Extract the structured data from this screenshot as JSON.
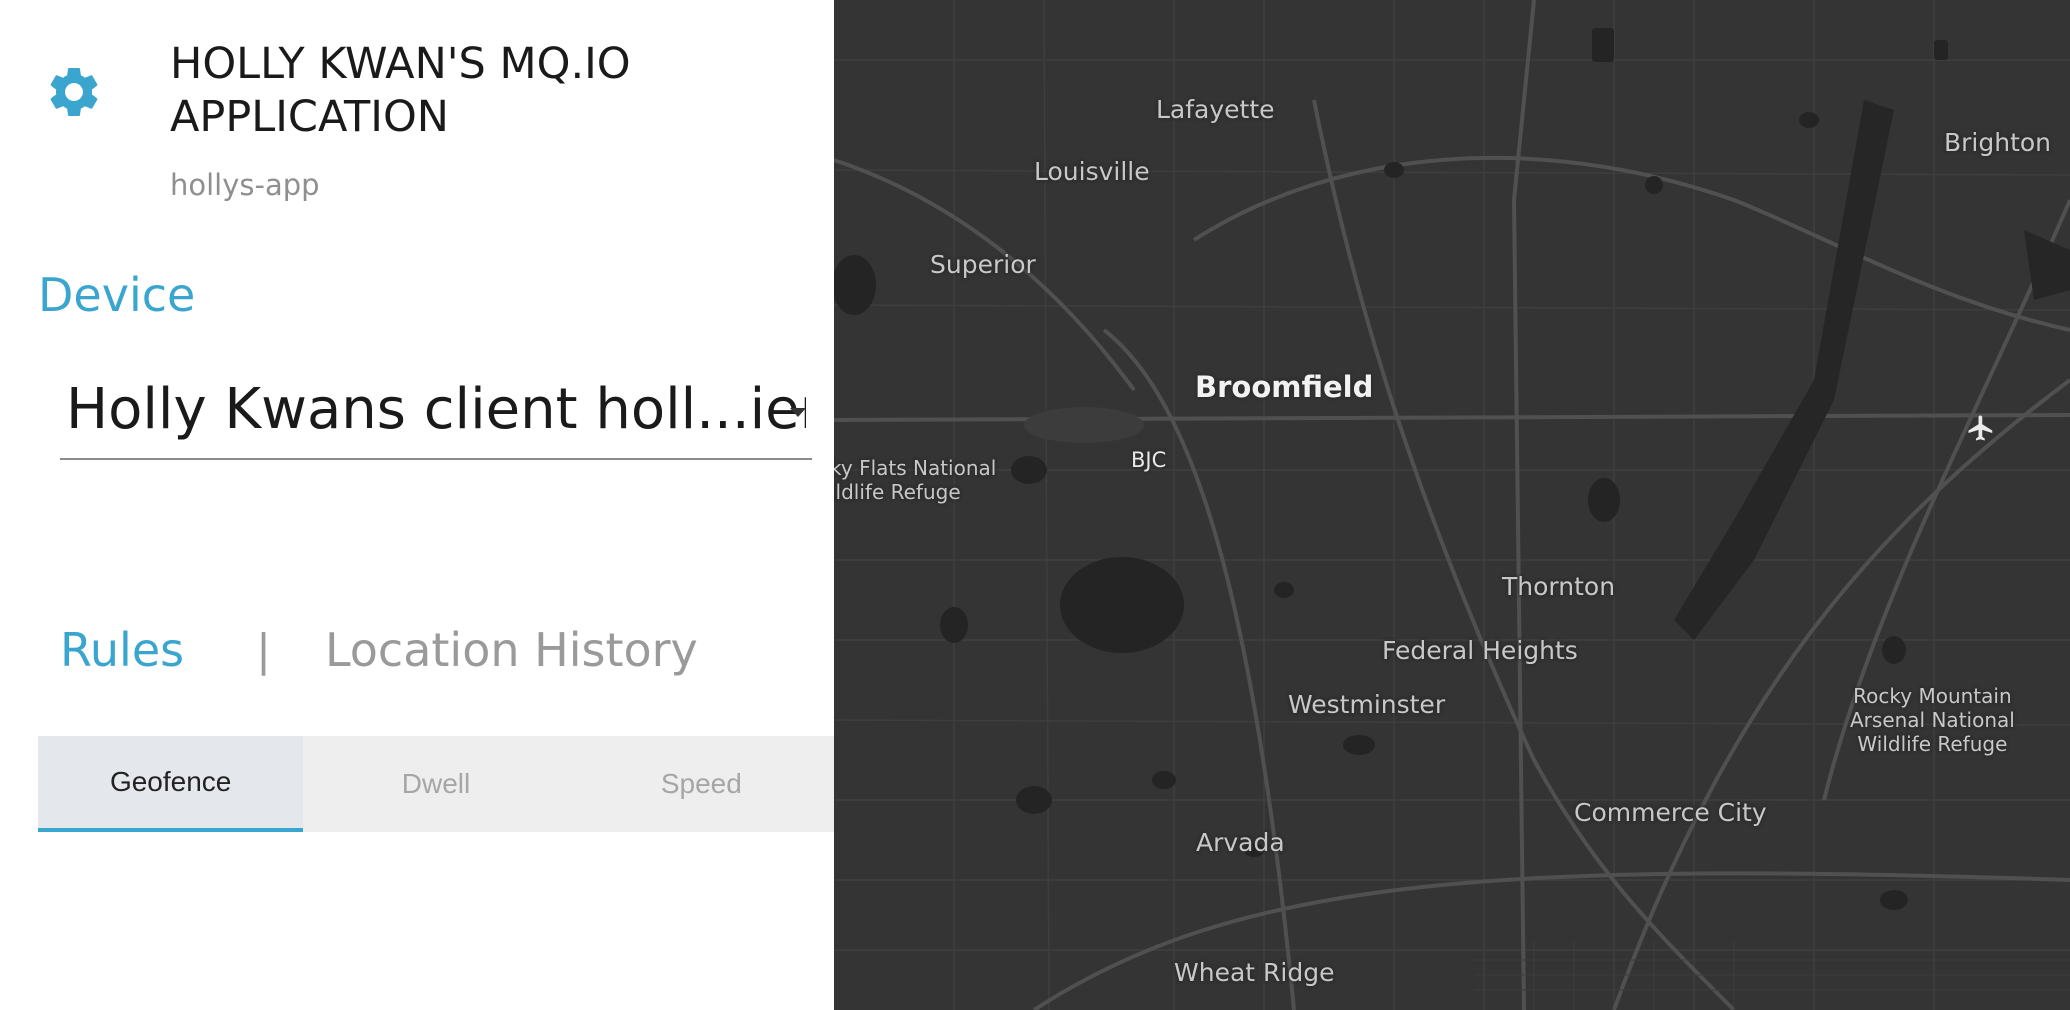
{
  "app": {
    "title": "HOLLY KWAN'S MQ.IO APPLICATION",
    "app_id": "hollys-app",
    "settings_icon": "gear-icon",
    "accent_color": "#3aa5cf"
  },
  "device": {
    "heading": "Device",
    "selected": "Holly Kwans client holl...ient"
  },
  "main_tabs": {
    "rules": "Rules",
    "divider": "|",
    "location_history": "Location History",
    "active": "Rules"
  },
  "rule_tabs": {
    "items": [
      {
        "label": "Geofence",
        "active": true
      },
      {
        "label": "Dwell",
        "active": false
      },
      {
        "label": "Speed",
        "active": false
      }
    ]
  },
  "map": {
    "labels": {
      "lafayette": "Lafayette",
      "louisville": "Louisville",
      "brighton": "Brighton",
      "superior": "Superior",
      "broomfield": "Broomfield",
      "bjc": "BJC",
      "rocky_flats": "ky Flats National\nildlife Refuge",
      "thornton": "Thornton",
      "federal_heights": "Federal Heights",
      "westminster": "Westminster",
      "rocky_mountain": "Rocky Mountain\nArsenal National\nWildlife Refuge",
      "commerce_city": "Commerce City",
      "arvada": "Arvada",
      "wheat_ridge": "Wheat Ridge"
    }
  }
}
